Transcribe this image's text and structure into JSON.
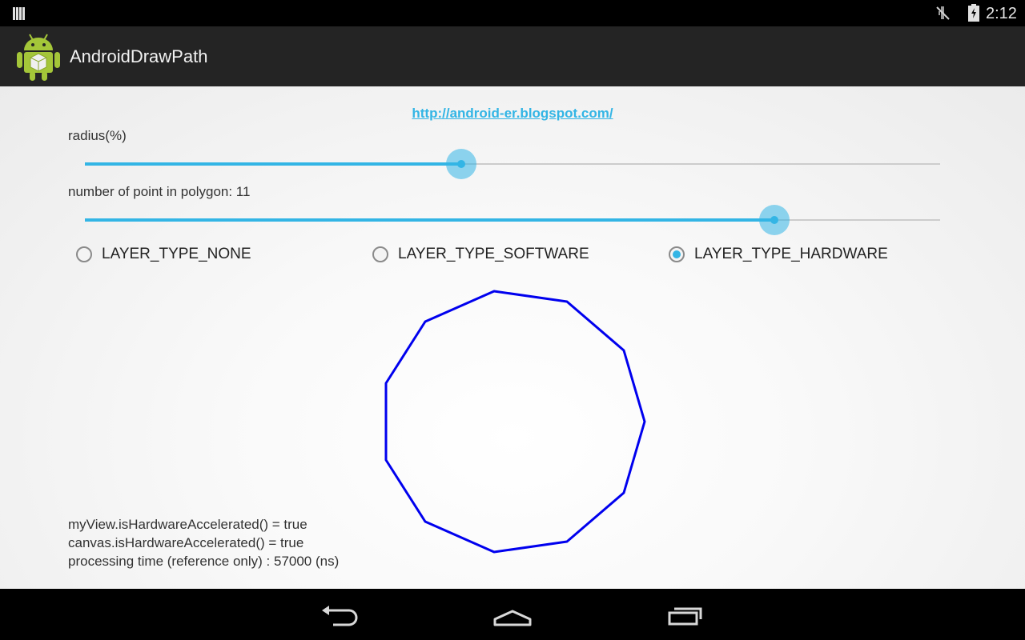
{
  "status_bar": {
    "time": "2:12"
  },
  "app": {
    "title": "AndroidDrawPath",
    "icon": "android-robot-icon"
  },
  "content": {
    "link": "http://android-er.blogspot.com/",
    "radius_label": "radius(%)",
    "radius_value": 0.44,
    "points_label": "number of point in polygon: 11",
    "points_value": 0.806,
    "layer_options": [
      {
        "label": "LAYER_TYPE_NONE",
        "checked": false
      },
      {
        "label": "LAYER_TYPE_SOFTWARE",
        "checked": false
      },
      {
        "label": "LAYER_TYPE_HARDWARE",
        "checked": true
      }
    ],
    "polygon": {
      "points": 11,
      "color": "#0000ee"
    },
    "info": [
      "myView.isHardwareAccelerated() = true",
      "canvas.isHardwareAccelerated() = true",
      "processing time (reference only) : 57000 (ns)"
    ]
  },
  "colors": {
    "accent": "#33b5e5",
    "action_bar": "#242424"
  },
  "nav": {
    "back": "back-icon",
    "home": "home-icon",
    "recent": "recent-apps-icon"
  }
}
